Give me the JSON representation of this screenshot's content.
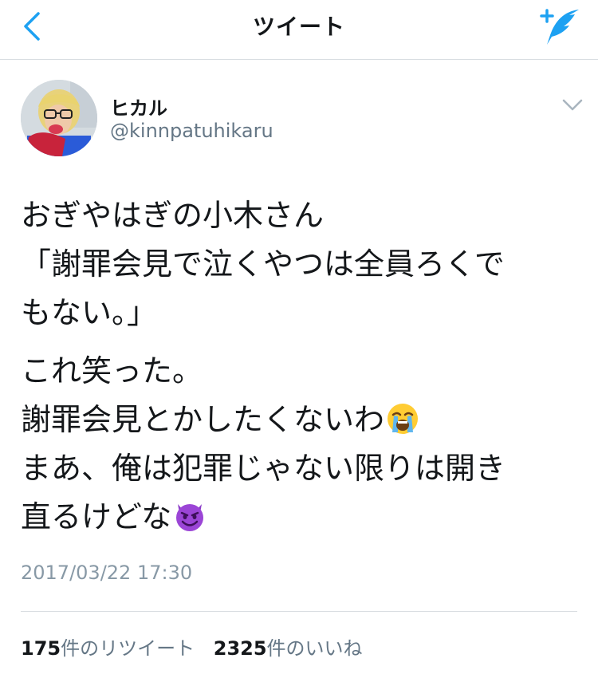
{
  "nav": {
    "title": "ツイート",
    "back_icon": "chevron-left-icon",
    "compose_icon": "compose-tweet-icon",
    "accent_color": "#1da1f2"
  },
  "tweet": {
    "author": {
      "display_name": "ヒカル",
      "handle": "@kinnpatuhikaru"
    },
    "text_paragraph_1": "おぎやはぎの小木さん\n「謝罪会見で泣くやつは全員ろくで\nもない。」",
    "text_paragraph_2_line_1": "これ笑った。",
    "text_paragraph_2_line_2": "謝罪会見とかしたくないわ",
    "text_paragraph_2_line_3": "まあ、俺は犯罪じゃない限りは開き",
    "text_paragraph_2_line_4": "直るけどな",
    "emoji_1": "loudly-crying-face-emoji",
    "emoji_2": "smiling-devil-face-emoji",
    "timestamp": "2017/03/22 17:30",
    "stats": {
      "retweets_count": "175",
      "retweets_label": "件のリツイート",
      "likes_count": "2325",
      "likes_label": "件のいいね"
    }
  }
}
